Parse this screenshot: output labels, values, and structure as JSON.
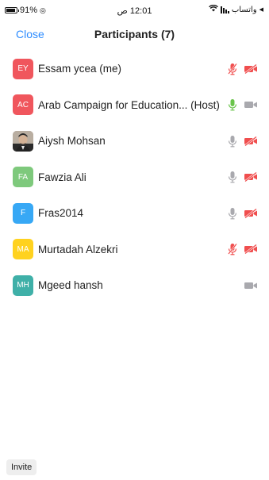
{
  "status_bar": {
    "battery": "91%",
    "battery_level": 0.91,
    "time": "12:01 ص",
    "carrier": "واتساب"
  },
  "nav": {
    "close_label": "Close",
    "title": "Participants (7)"
  },
  "participants": [
    {
      "initials": "EY",
      "avatar_color": "#f0565d",
      "name": "Essam ycea (me)",
      "mic": "muted",
      "video": "off"
    },
    {
      "initials": "AC",
      "avatar_color": "#f0565d",
      "name": "Arab Campaign for Education... (Host)",
      "mic": "on",
      "video": "on"
    },
    {
      "initials": "",
      "avatar_color": "#9a8f85",
      "name": "Aiysh Mohsan",
      "mic": "idle",
      "video": "off"
    },
    {
      "initials": "FA",
      "avatar_color": "#7ec97c",
      "name": "Fawzia Ali",
      "mic": "idle",
      "video": "off"
    },
    {
      "initials": "F",
      "avatar_color": "#37a8f5",
      "name": "Fras2014",
      "mic": "idle",
      "video": "off"
    },
    {
      "initials": "MA",
      "avatar_color": "#ffd21f",
      "name": "Murtadah Alzekri",
      "mic": "muted",
      "video": "off"
    },
    {
      "initials": "MH",
      "avatar_color": "#3fb0a8",
      "name": "Mgeed hansh",
      "mic": "none",
      "video": "on"
    }
  ],
  "colors": {
    "accent": "#2d8cff",
    "muted_red": "#f04e4e",
    "mic_green": "#6ac44b",
    "icon_gray": "#a9a9ae"
  },
  "invite_label": "Invite"
}
